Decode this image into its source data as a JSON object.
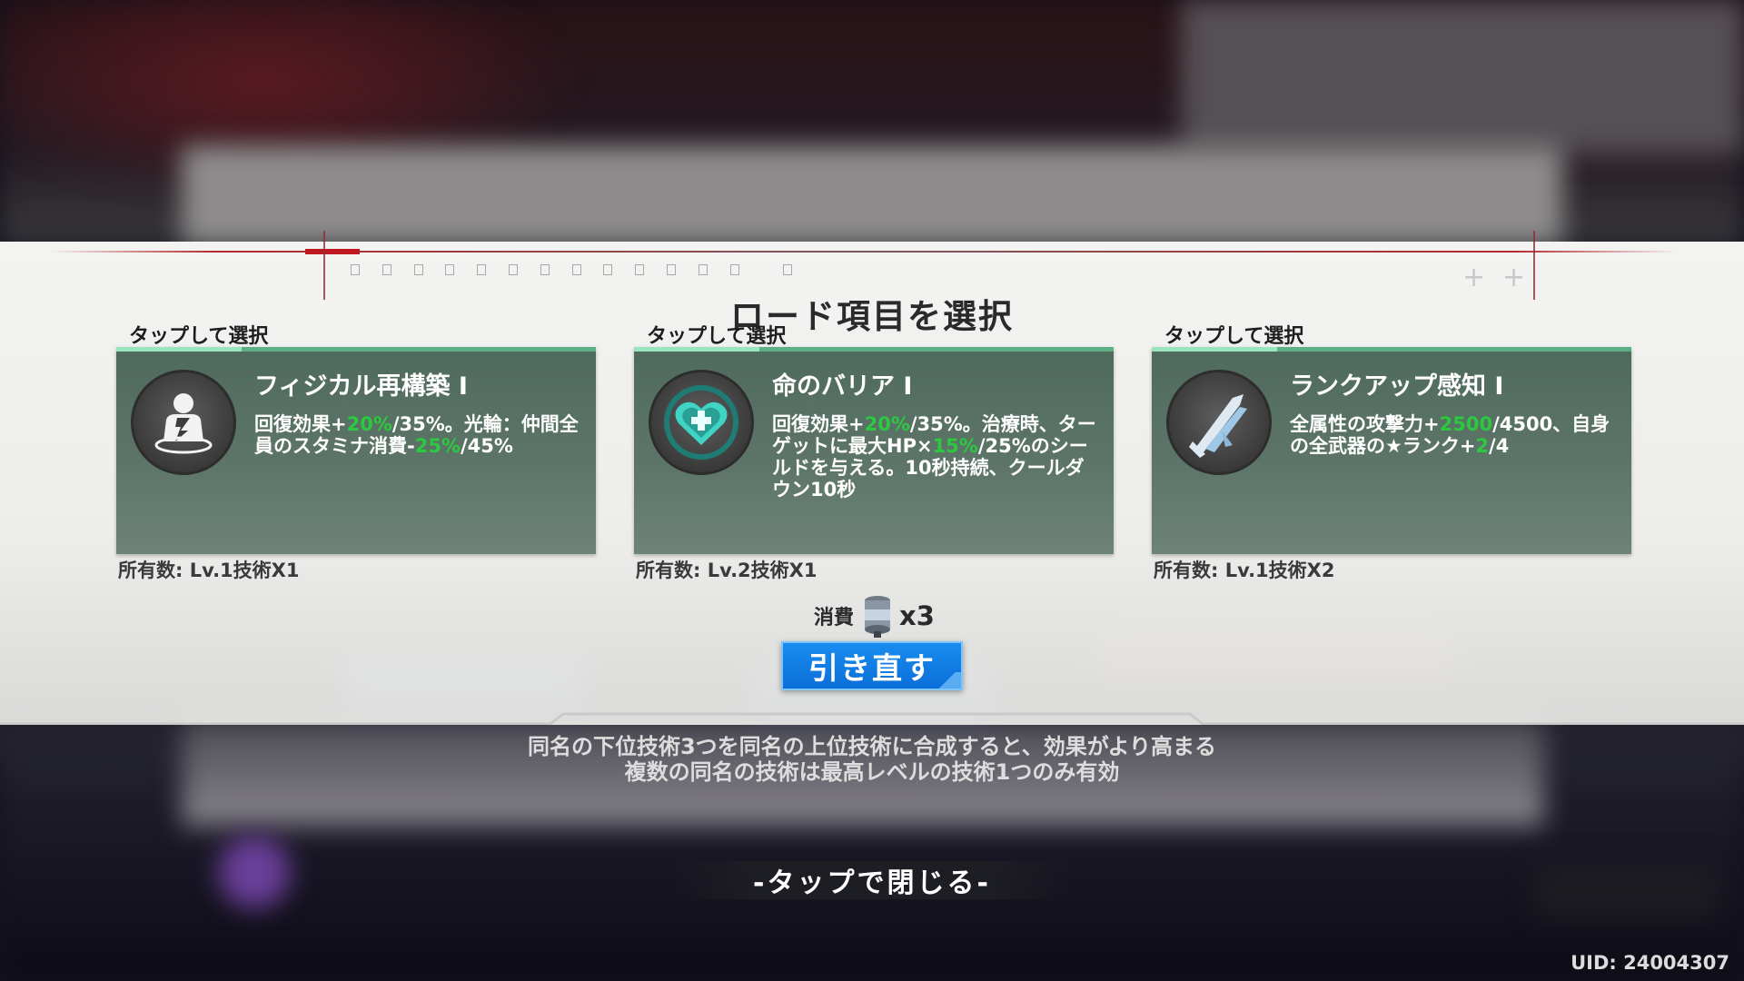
{
  "header": {
    "title": "ロード項目を選択"
  },
  "cards": [
    {
      "tap_label": "タップして選択",
      "title": "フィジカル再構築 I",
      "desc": [
        {
          "t": "回復効果+",
          "hl": false
        },
        {
          "t": "20%",
          "hl": true
        },
        {
          "t": "/35%。光輪：仲間全員のスタミナ消費-",
          "hl": false
        },
        {
          "t": "25%",
          "hl": true
        },
        {
          "t": "/45%",
          "hl": false
        }
      ],
      "owned": "所有数: Lv.1技術X1",
      "icon": "physical-figure-icon"
    },
    {
      "tap_label": "タップして選択",
      "title": "命のバリア I",
      "desc": [
        {
          "t": "回復効果+",
          "hl": false
        },
        {
          "t": "20%",
          "hl": true
        },
        {
          "t": "/35%。治療時、ターゲットに最大HP×",
          "hl": false
        },
        {
          "t": "15%",
          "hl": true
        },
        {
          "t": "/25%のシールドを与える。10秒持続、クールダウン10秒",
          "hl": false
        }
      ],
      "owned": "所有数: Lv.2技術X1",
      "icon": "heart-shield-icon"
    },
    {
      "tap_label": "タップして選択",
      "title": "ランクアップ感知 I",
      "desc": [
        {
          "t": "全属性の攻撃力+",
          "hl": false
        },
        {
          "t": "2500",
          "hl": true
        },
        {
          "t": "/4500、自身の全武器の★ランク+",
          "hl": false
        },
        {
          "t": "2",
          "hl": true
        },
        {
          "t": "/4",
          "hl": false
        }
      ],
      "owned": "所有数: Lv.1技術X2",
      "icon": "blades-icon"
    }
  ],
  "consume": {
    "label": "消費",
    "count": "x3",
    "icon": "reroll-canister-icon"
  },
  "reroll": {
    "label": "引き直す"
  },
  "info": {
    "line1": "同名の下位技術3つを同名の上位技術に合成すると、効果がより高まる",
    "line2": "複数の同名の技術は最高レベルの技術1つのみ有効"
  },
  "close_hint": "-タップで閉じる-",
  "uid": "UID: 24004307",
  "colors": {
    "highlight": "#2cc940",
    "card_bg": "#5a7265",
    "accent": "#5cb083",
    "button": "#0a6fd8"
  }
}
